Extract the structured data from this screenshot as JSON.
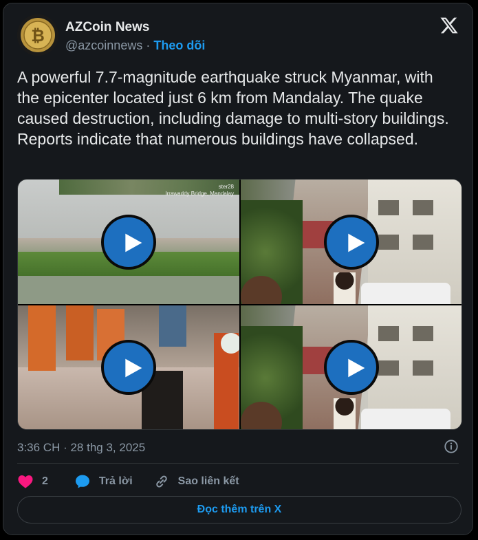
{
  "header": {
    "display_name": "AZCoin News",
    "handle": "@azcoinnews",
    "separator": "·",
    "follow_label": "Theo dõi"
  },
  "tweet": {
    "text": "A powerful 7.7-magnitude earthquake struck Myanmar, with the epicenter located just 6 km from Mandalay. The quake caused destruction, including damage to multi-story buildings. Reports indicate that numerous buildings have collapsed."
  },
  "media": {
    "tiles": [
      {
        "type": "video",
        "caption": "Irrawaddy Bridge, Mandalay",
        "caption_top": "ster28"
      },
      {
        "type": "video"
      },
      {
        "type": "video"
      },
      {
        "type": "video"
      }
    ]
  },
  "meta": {
    "timestamp": "3:36 CH · 28 thg 3, 2025"
  },
  "actions": {
    "like_count": "2",
    "reply_label": "Trả lời",
    "copy_link_label": "Sao liên kết"
  },
  "footer": {
    "read_more_label": "Đọc thêm trên X"
  },
  "colors": {
    "accent": "#1d9bf0",
    "like": "#f91880",
    "background": "#15181c"
  },
  "icons": [
    "bitcoin-avatar",
    "x-logo-icon",
    "play-icon",
    "info-icon",
    "heart-icon",
    "reply-icon",
    "link-icon"
  ]
}
